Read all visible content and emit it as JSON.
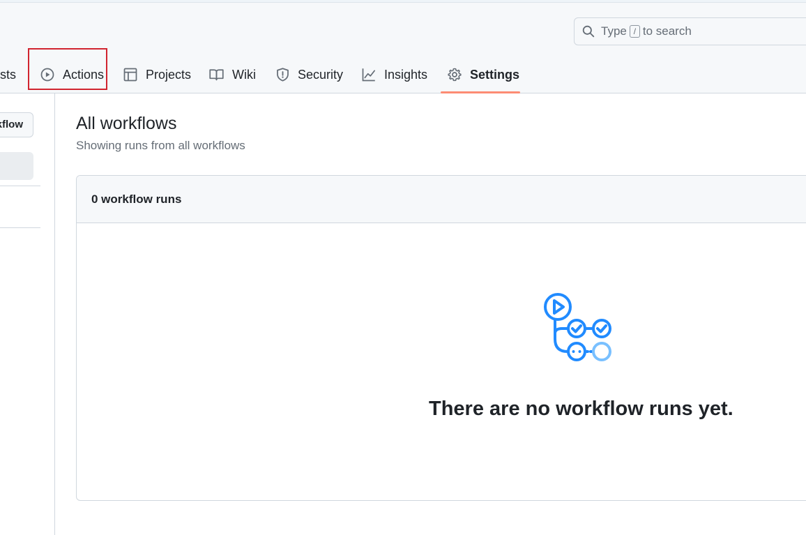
{
  "search": {
    "prefix": "Type",
    "key": "/",
    "suffix": "to search"
  },
  "tabs": [
    {
      "label": "ests",
      "icon": "pull-request-icon"
    },
    {
      "label": "Actions",
      "icon": "play-icon"
    },
    {
      "label": "Projects",
      "icon": "table-icon"
    },
    {
      "label": "Wiki",
      "icon": "book-icon"
    },
    {
      "label": "Security",
      "icon": "shield-icon"
    },
    {
      "label": "Insights",
      "icon": "graph-icon"
    },
    {
      "label": "Settings",
      "icon": "gear-icon",
      "selected": true
    }
  ],
  "sidebar": {
    "new_workflow_label": "kflow"
  },
  "main": {
    "title": "All workflows",
    "subtitle": "Showing runs from all workflows",
    "runs_count_label": "0 workflow runs",
    "empty_message": "There are no workflow runs yet."
  },
  "colors": {
    "accent_underline": "#fd8c73",
    "highlight": "#d1242f",
    "workflow_icon": "#218bff"
  }
}
